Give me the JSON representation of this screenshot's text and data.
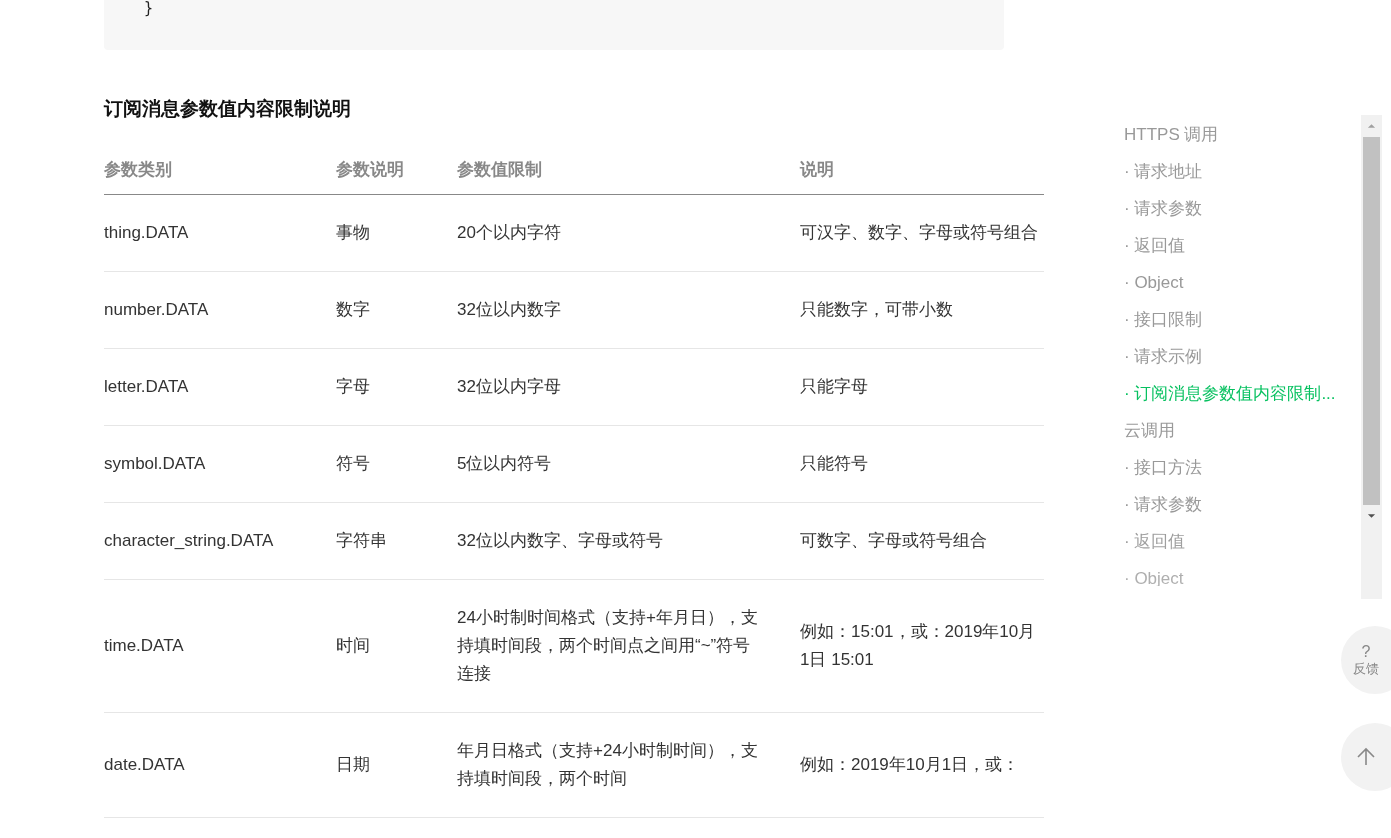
{
  "code_block": {
    "last_line": "}"
  },
  "section_title": "订阅消息参数值内容限制说明",
  "table": {
    "columns": [
      "参数类别",
      "参数说明",
      "参数值限制",
      "说明"
    ],
    "rows": [
      [
        "thing.DATA",
        "事物",
        "20个以内字符",
        "可汉字、数字、字母或符号组合"
      ],
      [
        "number.DATA",
        "数字",
        "32位以内数字",
        "只能数字，可带小数"
      ],
      [
        "letter.DATA",
        "字母",
        "32位以内字母",
        "只能字母"
      ],
      [
        "symbol.DATA",
        "符号",
        "5位以内符号",
        "只能符号"
      ],
      [
        "character_string.DATA",
        "字符串",
        "32位以内数字、字母或符号",
        "可数字、字母或符号组合"
      ],
      [
        "time.DATA",
        "时间",
        "24小时制时间格式（支持+年月日），支持填时间段，两个时间点之间用“~”符号连接",
        "例如：15:01，或：2019年10月1日 15:01"
      ],
      [
        "date.DATA",
        "日期",
        "年月日格式（支持+24小时制时间），支持填时间段，两个时间",
        "例如：2019年10月1日，或："
      ]
    ]
  },
  "toc": {
    "items": [
      {
        "label": "HTTPS 调用",
        "selected": false
      },
      {
        "label": "· 请求地址",
        "selected": false
      },
      {
        "label": "· 请求参数",
        "selected": false
      },
      {
        "label": "· 返回值",
        "selected": false
      },
      {
        "label": "· Object",
        "selected": false
      },
      {
        "label": "· 接口限制",
        "selected": false
      },
      {
        "label": "· 请求示例",
        "selected": false
      },
      {
        "label": "· 订阅消息参数值内容限制...",
        "selected": true
      },
      {
        "label": "云调用",
        "selected": false
      },
      {
        "label": "· 接口方法",
        "selected": false
      },
      {
        "label": "· 请求参数",
        "selected": false
      },
      {
        "label": "· 返回值",
        "selected": false
      },
      {
        "label": "· Object",
        "selected": false
      }
    ]
  },
  "feedback_button": {
    "icon": "?",
    "label": "反馈"
  }
}
